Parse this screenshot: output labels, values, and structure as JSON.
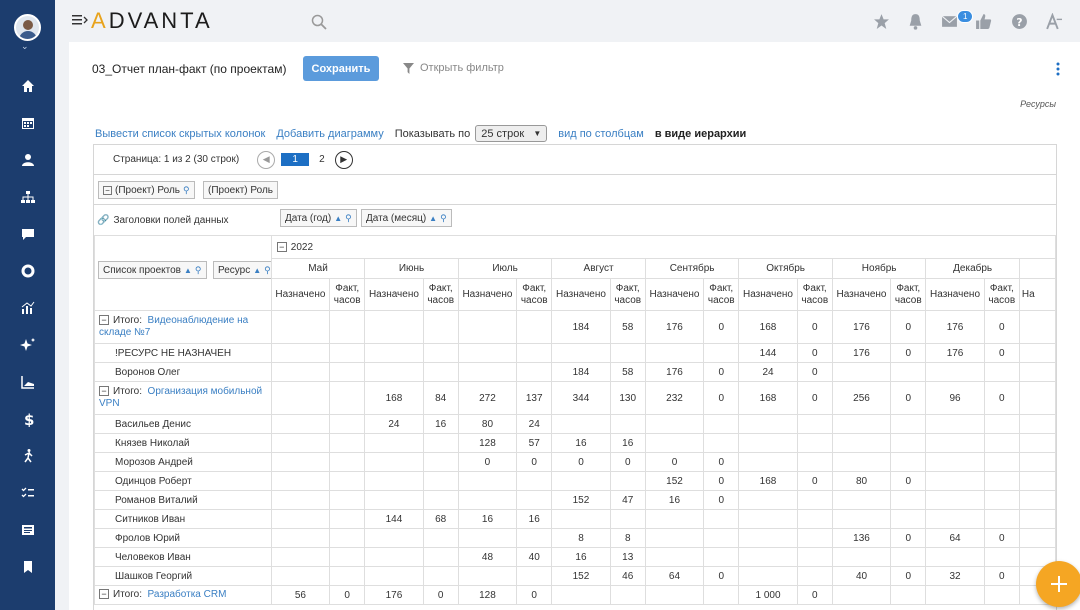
{
  "topbar": {
    "logo_prefix": "A",
    "logo_rest": "DVANTA",
    "notif_count": "1"
  },
  "page": {
    "title": "03_Отчет план-факт (по проектам)",
    "save_label": "Сохранить",
    "filter_label": "Открыть фильтр",
    "resources_label": "Ресурсы"
  },
  "toolbar": {
    "hidden_cols": "Вывести список скрытых колонок",
    "add_chart": "Добавить диаграмму",
    "show_label": "Показывать по",
    "rows_select": "25 строк",
    "col_view": "вид по столбцам",
    "hier_view": "в виде иерархии"
  },
  "pager": {
    "info": "Страница: 1 из 2 (30 строк)",
    "page1": "1",
    "page2": "2"
  },
  "filters": {
    "role_chip": "(Проект) Роль",
    "role_chip2": "(Проект) Роль",
    "data_headers": "Заголовки полей данных",
    "year_chip": "Дата (год)",
    "month_chip": "Дата (месяц)",
    "projects_chip": "Список проектов",
    "resource_chip": "Ресурс"
  },
  "table": {
    "year": "2022",
    "months": [
      "Май",
      "Июнь",
      "Июль",
      "Август",
      "Сентябрь",
      "Октябрь",
      "Ноябрь",
      "Декабрь"
    ],
    "planned": "Назначено",
    "actual": "Факт, часов",
    "partial_col": "На",
    "total_label": "Итого:",
    "rows": [
      {
        "type": "total",
        "project": "Видеонаблюдение на складе №7",
        "cells": [
          "",
          "",
          "",
          "",
          "",
          "",
          "184",
          "58",
          "176",
          "0",
          "168",
          "0",
          "176",
          "0",
          "176",
          "0"
        ]
      },
      {
        "type": "res",
        "name": "!РЕСУРС НЕ НАЗНАЧЕН",
        "cells": [
          "",
          "",
          "",
          "",
          "",
          "",
          "",
          "",
          "",
          "",
          "144",
          "0",
          "176",
          "0",
          "176",
          "0"
        ]
      },
      {
        "type": "res",
        "name": "Воронов Олег",
        "cells": [
          "",
          "",
          "",
          "",
          "",
          "",
          "184",
          "58",
          "176",
          "0",
          "24",
          "0",
          "",
          "",
          "",
          ""
        ]
      },
      {
        "type": "total",
        "project": "Организация мобильной VPN",
        "cells": [
          "",
          "",
          "168",
          "84",
          "272",
          "137",
          "344",
          "130",
          "232",
          "0",
          "168",
          "0",
          "256",
          "0",
          "96",
          "0"
        ]
      },
      {
        "type": "res",
        "name": "Васильев Денис",
        "cells": [
          "",
          "",
          "24",
          "16",
          "80",
          "24",
          "",
          "",
          "",
          "",
          "",
          "",
          "",
          "",
          "",
          ""
        ]
      },
      {
        "type": "res",
        "name": "Князев Николай",
        "cells": [
          "",
          "",
          "",
          "",
          "128",
          "57",
          "16",
          "16",
          "",
          "",
          "",
          "",
          "",
          "",
          "",
          ""
        ]
      },
      {
        "type": "res",
        "name": "Морозов Андрей",
        "cells": [
          "",
          "",
          "",
          "",
          "0",
          "0",
          "0",
          "0",
          "0",
          "0",
          "",
          "",
          "",
          "",
          "",
          ""
        ]
      },
      {
        "type": "res",
        "name": "Одинцов Роберт",
        "cells": [
          "",
          "",
          "",
          "",
          "",
          "",
          "",
          "",
          "152",
          "0",
          "168",
          "0",
          "80",
          "0",
          "",
          ""
        ]
      },
      {
        "type": "res",
        "name": "Романов Виталий",
        "cells": [
          "",
          "",
          "",
          "",
          "",
          "",
          "152",
          "47",
          "16",
          "0",
          "",
          "",
          "",
          "",
          "",
          ""
        ]
      },
      {
        "type": "res",
        "name": "Ситников Иван",
        "cells": [
          "",
          "",
          "144",
          "68",
          "16",
          "16",
          "",
          "",
          "",
          "",
          "",
          "",
          "",
          "",
          "",
          ""
        ]
      },
      {
        "type": "res",
        "name": "Фролов Юрий",
        "cells": [
          "",
          "",
          "",
          "",
          "",
          "",
          "8",
          "8",
          "",
          "",
          "",
          "",
          "136",
          "0",
          "64",
          "0"
        ]
      },
      {
        "type": "res",
        "name": "Человеков Иван",
        "cells": [
          "",
          "",
          "",
          "",
          "48",
          "40",
          "16",
          "13",
          "",
          "",
          "",
          "",
          "",
          "",
          "",
          ""
        ]
      },
      {
        "type": "res",
        "name": "Шашков Георгий",
        "cells": [
          "",
          "",
          "",
          "",
          "",
          "",
          "152",
          "46",
          "64",
          "0",
          "",
          "",
          "40",
          "0",
          "32",
          "0"
        ]
      },
      {
        "type": "total",
        "project": "Разработка CRM",
        "cells": [
          "56",
          "0",
          "176",
          "0",
          "128",
          "0",
          "",
          "",
          "",
          "",
          "1 000",
          "0",
          "",
          "",
          "",
          ""
        ]
      }
    ]
  }
}
